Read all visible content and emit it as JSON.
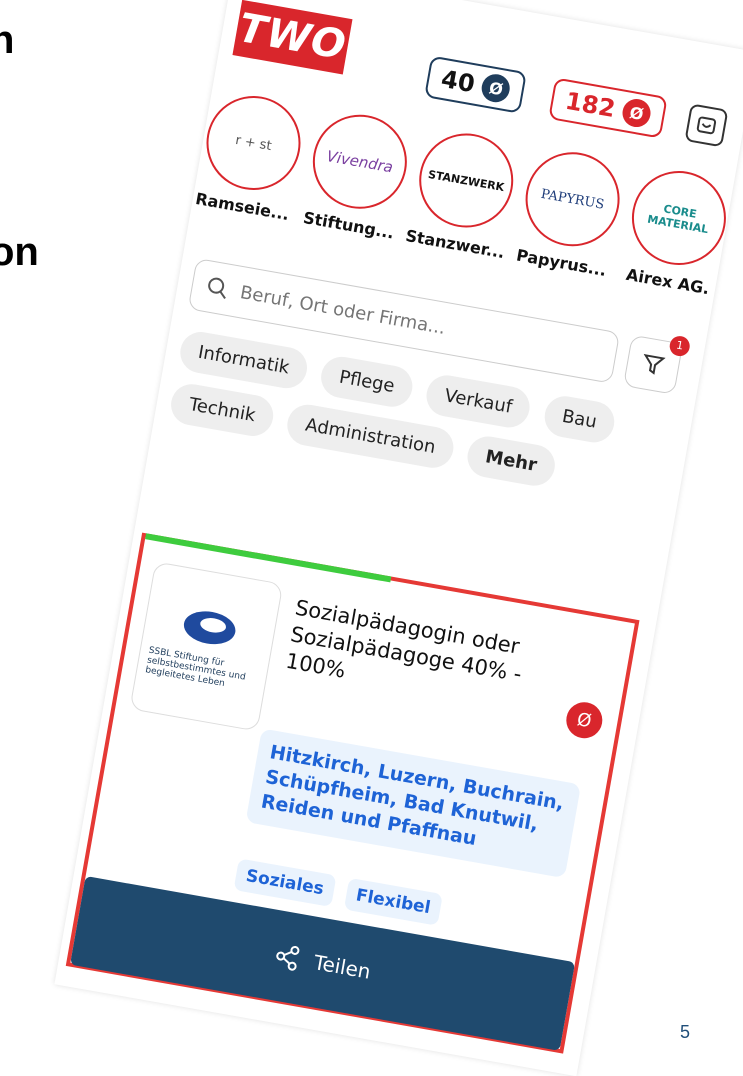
{
  "slide": {
    "fragment_1": "n",
    "fragment_2": "on",
    "page_number": "5"
  },
  "app": {
    "logo": "TWO",
    "counter_blue": "40",
    "counter_red": "182",
    "coin_symbol": "Ø"
  },
  "companies": [
    {
      "name": "Ramseie...",
      "logo_text": "r + st"
    },
    {
      "name": "Stiftung...",
      "logo_text": "Vivendra"
    },
    {
      "name": "Stanzwer...",
      "logo_text": "STANZWERK"
    },
    {
      "name": "Papyrus...",
      "logo_text": "PAPYRUS"
    },
    {
      "name": "Airex AG.",
      "logo_text": "CORE MATERIAL"
    }
  ],
  "search": {
    "placeholder": "Beruf, Ort oder Firma...",
    "filter_count": "1"
  },
  "chips": [
    "Informatik",
    "Pflege",
    "Bau",
    "Technik",
    "Verkauf",
    "Administration",
    "Mehr"
  ],
  "job": {
    "logo_text": "SSBL Stiftung für selbstbestimmtes und begleitetes Leben",
    "title": "Sozialpädagogin oder Sozialpädagoge 40% - 100%",
    "locations": "Hitzkirch, Luzern, Buchrain, Schüpfheim, Bad Knutwil, Reiden und Pfaffnau",
    "tags": [
      "Soziales",
      "Flexibel"
    ],
    "progress": 0.5,
    "share_label": "Teilen"
  },
  "colors": {
    "brand_red": "#d9262c",
    "navy": "#1f4a6e",
    "link_blue": "#1e63d6",
    "progress_green": "#3ecc3e"
  }
}
